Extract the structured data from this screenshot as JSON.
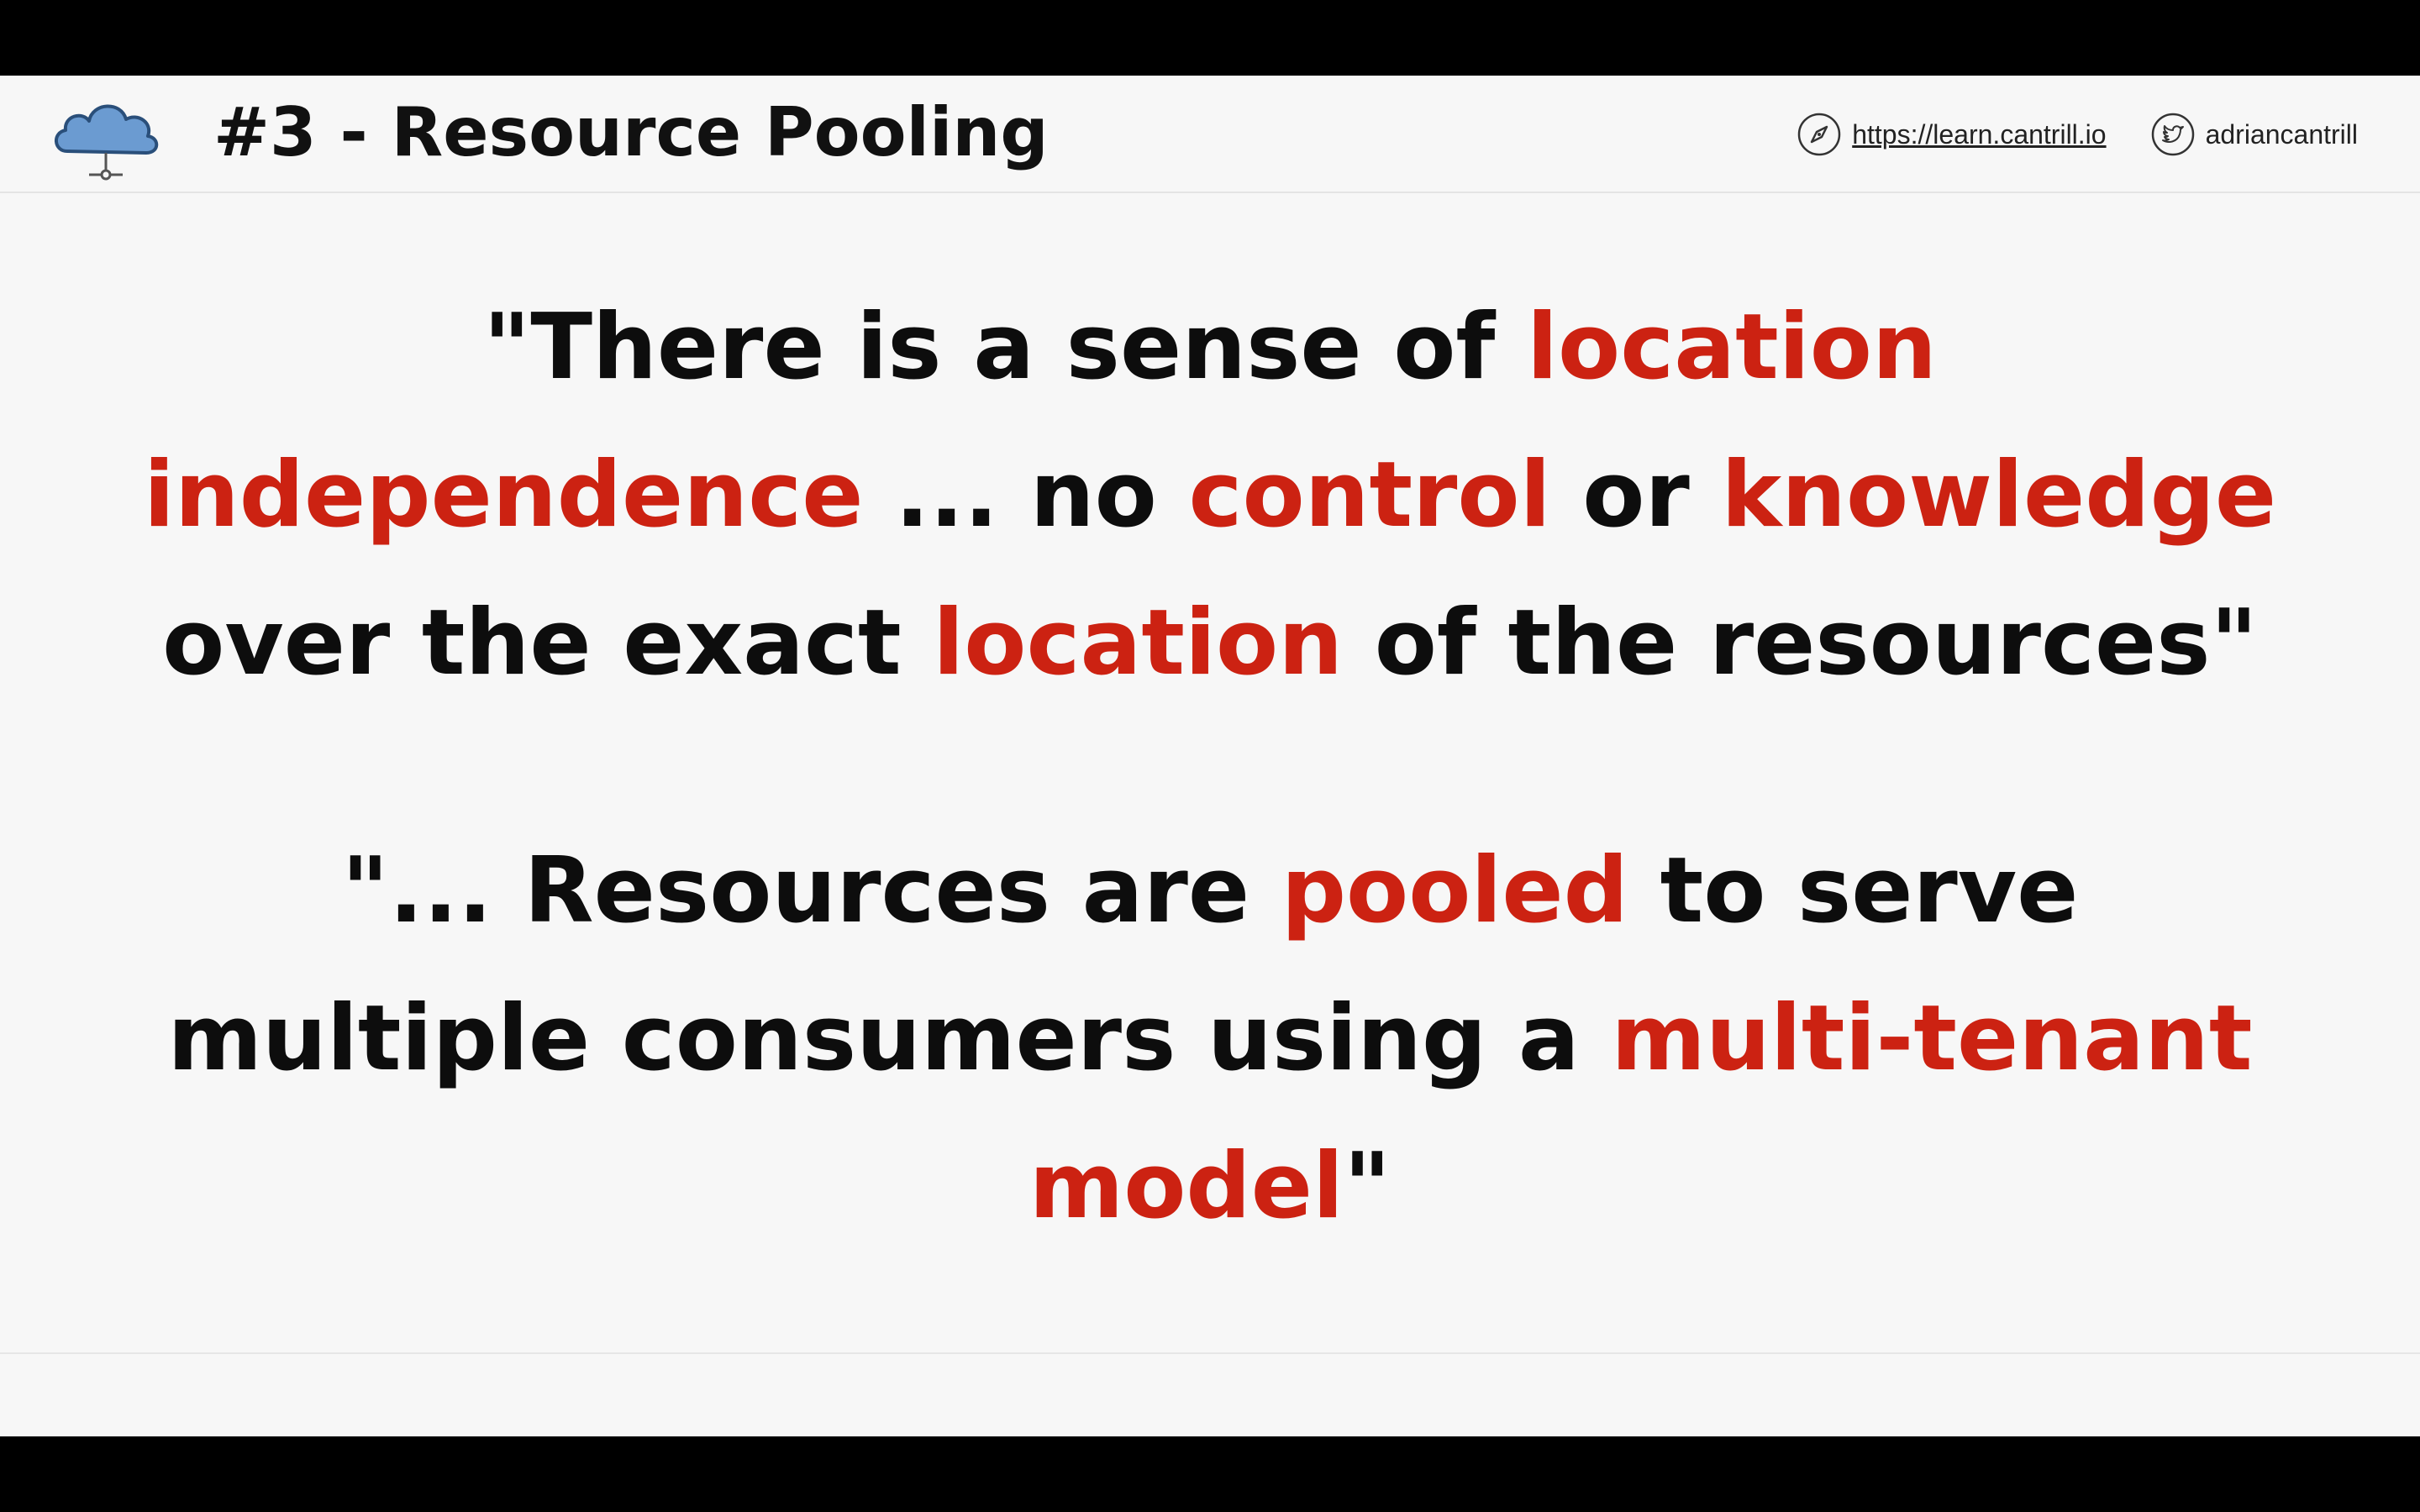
{
  "header": {
    "title": "#3 - Resource Pooling",
    "website_label": "https://learn.cantrill.io",
    "twitter_handle": "adriancantrill",
    "logo_icon": "cloud-network-icon",
    "website_icon": "compass-icon",
    "twitter_icon": "twitter-bird-icon"
  },
  "quote1": {
    "l1a": "\"There is a sense of ",
    "l1b": "location",
    "l2a": "independence",
    "l2b": " ... no ",
    "l2c": "control",
    "l2d": " or ",
    "l2e": "knowledge",
    "l3a": "over the exact ",
    "l3b": "location",
    "l3c": " of the resources\""
  },
  "quote2": {
    "l1a": "\"... Resources are ",
    "l1b": "pooled",
    "l1c": " to serve",
    "l2a": "multiple consumers using a ",
    "l2b": "multi-tenant",
    "l3a": "model",
    "l3b": "\""
  },
  "colors": {
    "highlight": "#cc2212",
    "text": "#0d0d0d",
    "background": "#f7f7f7"
  }
}
